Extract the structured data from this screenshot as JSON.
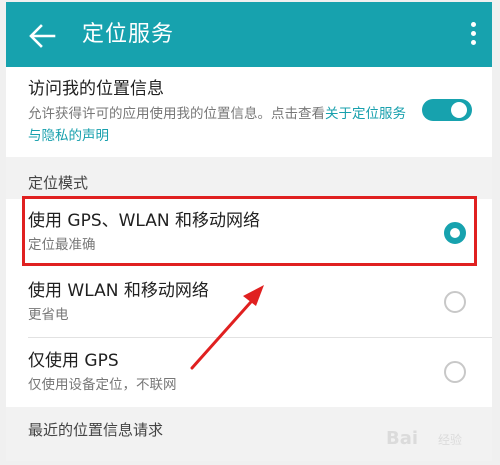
{
  "app_bar": {
    "title": "定位服务",
    "back_icon": "arrow-left-icon",
    "more_icon": "more-vertical-icon",
    "background": "#17a2ae"
  },
  "access": {
    "label": "访问我的位置信息",
    "description_plain": "允许获得许可的应用使用我的位置信息。点击查看",
    "description_link": "关于定位服务与隐私的声明",
    "toggle_on": true
  },
  "mode_section": {
    "header": "定位模式",
    "options": [
      {
        "label": "使用 GPS、WLAN 和移动网络",
        "sublabel": "定位最准确",
        "selected": true
      },
      {
        "label": "使用 WLAN 和移动网络",
        "sublabel": "更省电",
        "selected": false
      },
      {
        "label": "仅使用 GPS",
        "sublabel": "仅使用设备定位，不联网",
        "selected": false
      }
    ]
  },
  "recent_section": {
    "header": "最近的位置信息请求"
  },
  "annotation": {
    "highlight_color": "#e02020",
    "arrow_color": "#e02020"
  },
  "watermark": {
    "text": "Bai",
    "sub": "经验"
  }
}
